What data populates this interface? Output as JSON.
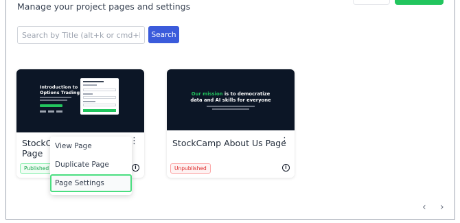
{
  "header": {
    "subtitle": "Manage your project pages and settings"
  },
  "search": {
    "placeholder": "Search by Title (alt+k or cmd+k)",
    "value": "",
    "button_label": "Search"
  },
  "cards": [
    {
      "title_line1": "StockCa",
      "title_line2": "Page",
      "status": "Published",
      "thumbnail": {
        "heading_line1": "Introduction to",
        "heading_line2": "Options Trading"
      }
    },
    {
      "title": "StockCamp About Us Page",
      "status": "Unpublished",
      "thumbnail": {
        "text_green": "Our mission",
        "text_rest": " is to democratize",
        "text_line2": "data and AI skills for everyone"
      }
    }
  ],
  "context_menu": {
    "items": [
      "View Page",
      "Duplicate Page",
      "Page Settings"
    ],
    "active_index": 2
  },
  "colors": {
    "accent_blue": "#3b5bdb",
    "accent_green": "#22c55e",
    "published": "#16a34a",
    "unpublished": "#dc2626"
  },
  "icons": {
    "kebab": "kebab-menu-icon",
    "info": "info-icon",
    "prev": "chevron-left-icon",
    "next": "chevron-right-icon"
  },
  "pager": {
    "prev_glyph": "‹",
    "next_glyph": "›"
  }
}
